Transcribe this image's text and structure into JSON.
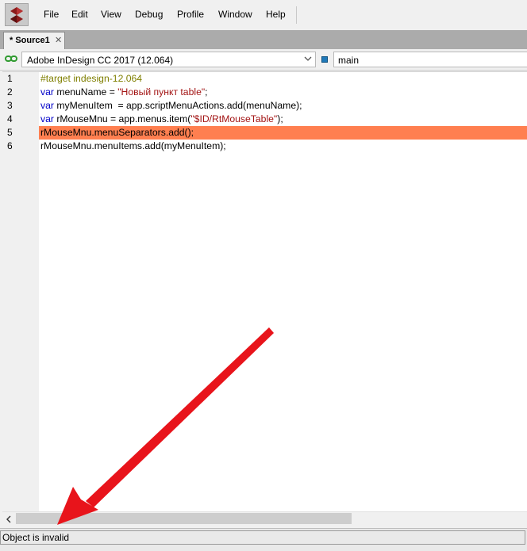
{
  "menubar": {
    "items": [
      {
        "label": "File"
      },
      {
        "label": "Edit"
      },
      {
        "label": "View"
      },
      {
        "label": "Debug"
      },
      {
        "label": "Profile"
      },
      {
        "label": "Window"
      },
      {
        "label": "Help"
      }
    ]
  },
  "tabs": [
    {
      "label": "* Source1",
      "close_glyph": "✕"
    }
  ],
  "target": {
    "application": "Adobe InDesign CC 2017 (12.064)",
    "function": "main"
  },
  "editor": {
    "highlighted_line": 5,
    "lines": [
      {
        "number": "1",
        "text": "#target indesign-12.064"
      },
      {
        "number": "2",
        "text": "var menuName = \"Новый пункт table\";"
      },
      {
        "number": "3",
        "text": "var myMenuItem  = app.scriptMenuActions.add(menuName);"
      },
      {
        "number": "4",
        "text": "var rMouseMnu = app.menus.item(\"$ID/RtMouseTable\");"
      },
      {
        "number": "5",
        "text": "rMouseMnu.menuSeparators.add();"
      },
      {
        "number": "6",
        "text": "rMouseMnu.menuItems.add(myMenuItem);"
      }
    ]
  },
  "status": {
    "message": "Object is invalid"
  },
  "colors": {
    "highlight_line": "#ff7f50",
    "keyword": "#0000c8",
    "string": "#a31515",
    "directive": "#7f7f00",
    "annotation_arrow": "#e8141b"
  },
  "icons": {
    "app_logo": "extendscript-toolkit-icon",
    "link": "link-icon",
    "function": "function-icon",
    "scroll_left": "scroll-left-arrow-icon"
  }
}
